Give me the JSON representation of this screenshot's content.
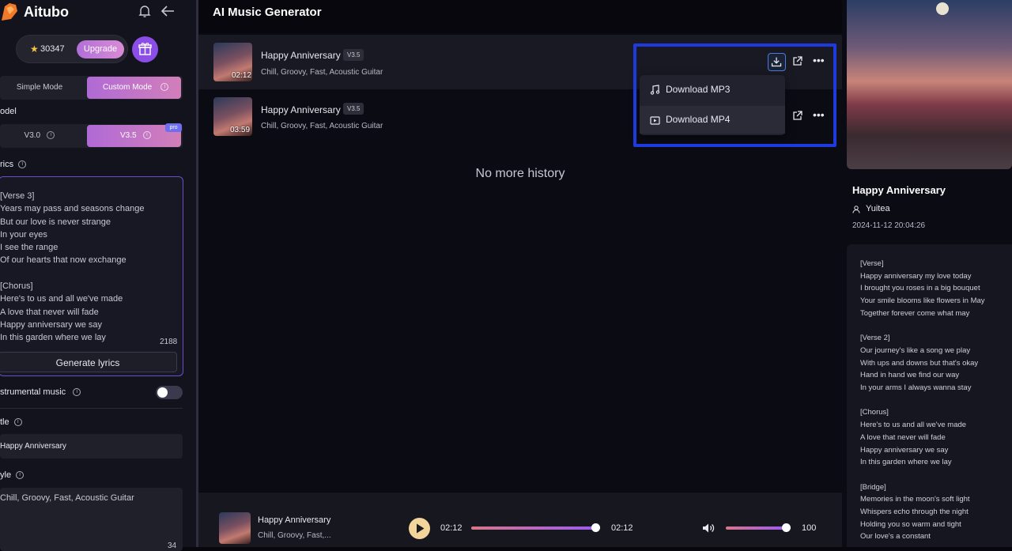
{
  "app": {
    "name": "Aitubo"
  },
  "credits": {
    "count": "30347",
    "upgrade_label": "Upgrade"
  },
  "modes": {
    "simple": "Simple Mode",
    "custom": "Custom Mode"
  },
  "model": {
    "label": "odel",
    "v30": "V3.0",
    "v35": "V3.5",
    "pro_badge": "pro"
  },
  "lyrics": {
    "label": "rics",
    "text": "[Verse 3]\nYears may pass and seasons change\nBut our love is never strange\nIn your eyes\nI see the range\nOf our hearts that now exchange\n\n[Chorus]\nHere's to us and all we've made\nA love that never will fade\nHappy anniversary we say\nIn this garden where we lay",
    "char_count": "2188",
    "generate_label": "Generate lyrics"
  },
  "instrumental": {
    "label": "strumental music",
    "enabled": false
  },
  "title_field": {
    "label": "tle",
    "value": "Happy Anniversary"
  },
  "style_field": {
    "label": "yle",
    "value": "Chill, Groovy, Fast, Acoustic Guitar",
    "count": "34"
  },
  "main": {
    "title": "AI Music Generator",
    "no_more": "No more history"
  },
  "songs": [
    {
      "title": "Happy Anniversary",
      "version": "V3.5",
      "tags": "Chill, Groovy, Fast, Acoustic Guitar",
      "duration": "02:12"
    },
    {
      "title": "Happy Anniversary",
      "version": "V3.5",
      "tags": "Chill, Groovy, Fast, Acoustic Guitar",
      "duration": "03:59"
    }
  ],
  "download_menu": {
    "mp3": "Download MP3",
    "mp4": "Download MP4"
  },
  "player": {
    "title": "Happy Anniversary",
    "tags": "Chill, Groovy, Fast,...",
    "current_time": "02:12",
    "total_time": "02:12",
    "progress": 1.0,
    "volume": "100",
    "volume_level": 1.0
  },
  "detail": {
    "title": "Happy Anniversary",
    "user": "Yuitea",
    "date": "2024-11-12 20:04:26",
    "lyrics": "[Verse]\nHappy anniversary my love today\nI brought you roses in a big bouquet\nYour smile blooms like flowers in May\nTogether forever come what may\n\n[Verse 2]\nOur journey's like a song we play\nWith ups and downs but that's okay\nHand in hand we find our way\nIn your arms I always wanna stay\n\n[Chorus]\nHere's to us and all we've made\nA love that never will fade\nHappy anniversary we say\nIn this garden where we lay\n\n[Bridge]\nMemories in the moon's soft light\nWhispers echo through the night\nHolding you so warm and tight\nOur love's a constant"
  },
  "colors": {
    "accent": "#b06ad6",
    "highlight": "#1e3adc",
    "play": "#f2d59a"
  }
}
